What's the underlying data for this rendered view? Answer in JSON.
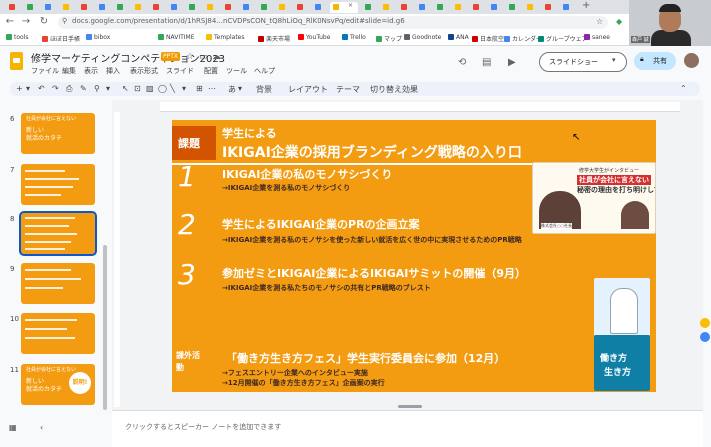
{
  "browser": {
    "url": "docs.google.com/presentation/d/1hRSJ84...nCVDPsCON_tQ8hLiOq_RlK0NsvPq/edit#slide=id.g6",
    "bookmarks": [
      "tools",
      "ほぼ日手帳",
      "bibox",
      "NAVITIME",
      "Templates",
      "楽天市場",
      "YouTube",
      "Trello",
      "マップ",
      "Goodnote",
      "ANA",
      "日本航空",
      "カレンダー",
      "グループウェア",
      "sanee"
    ]
  },
  "webcam": {
    "name": "森戸 誠"
  },
  "doc": {
    "title": "修学マーケティングコンペティション2023",
    "badge": "PPTX",
    "menus": [
      "ファイル",
      "編集",
      "表示",
      "挿入",
      "表示形式",
      "スライド",
      "配置",
      "ツール",
      "ヘルプ"
    ],
    "slideshow_label": "スライドショー",
    "share_label": "共有"
  },
  "toolbar": {
    "background": "背景",
    "layout": "レイアウト",
    "theme": "テーマ",
    "transition": "切り替え効果"
  },
  "filmstrip": {
    "slides": [
      {
        "num": "6",
        "text1": "社員が会社に言えない",
        "text2": "新しい",
        "text3": "就活のカタチ"
      },
      {
        "num": "7",
        "text1": "",
        "text2": "",
        "text3": ""
      },
      {
        "num": "8",
        "text1": "",
        "text2": "",
        "text3": ""
      },
      {
        "num": "9",
        "text1": "",
        "text2": "",
        "text3": ""
      },
      {
        "num": "10",
        "text1": "",
        "text2": "",
        "text3": ""
      },
      {
        "num": "11",
        "text1": "社員が会社に言えない",
        "text2": "新しい",
        "text3": "就活のカタチ"
      }
    ],
    "badge11": "説明!"
  },
  "slide": {
    "label": "課題",
    "subtitle": "学生による",
    "title": "IKIGAI企業の採用ブランディング戦略の入り口",
    "points": [
      {
        "num": "1",
        "title": "IKIGAI企業の私のモノサシづくり",
        "desc": "→IKIGAI企業を測る私のモノサシづくり"
      },
      {
        "num": "2",
        "title": "学生によるIKIGAI企業のPRの企画立案",
        "desc": "→IKIGAI企業を測る私のモノサシを使った新しい就活を広く世の中に実現させるためのPR戦略"
      },
      {
        "num": "3",
        "title": "参加ゼミとIKIGAI企業によるIKIGAIサミットの開催（9月）",
        "desc": "→IKIGAI企業を測る私たちのモノサシの共有とPR戦略のブレスト"
      }
    ],
    "extra_label": "課外活動",
    "extra_title": "「働き方生き方フェス」学生実行委員会に参加（12月）",
    "extra_desc1": "→フェスエントリー企業へのインタビュー実施",
    "extra_desc2": "→12月開催の「働き方生き方フェス」企画案の実行",
    "promo1_head": "修学大学生がインタビュー",
    "promo1_big": "社員が会社に言えない",
    "promo1_big2": "秘密の理由を打ち明けしてる",
    "promo1_cap": "株式会社○○社長",
    "promo3_t": "働き方",
    "promo3_t2": "生き方"
  },
  "notes": {
    "placeholder": "クリックするとスピーカー ノートを追加できます"
  }
}
